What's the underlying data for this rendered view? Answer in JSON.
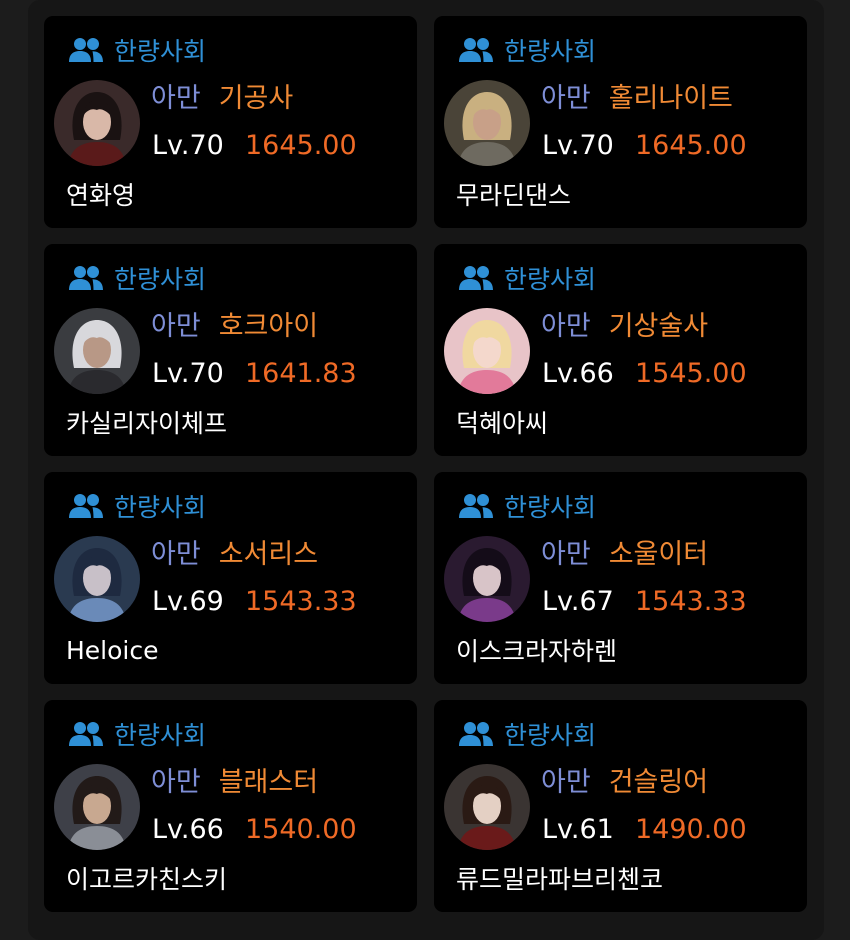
{
  "characters": [
    {
      "guild": "한량사회",
      "server": "아만",
      "class": "기공사",
      "level": "Lv.70",
      "item_level": "1645.00",
      "name": "연화영",
      "avatar": {
        "bg": "#3a2a2a",
        "hair": "#1a1212",
        "skin": "#d9b8a8",
        "accent": "#5a1a1a"
      }
    },
    {
      "guild": "한량사회",
      "server": "아만",
      "class": "홀리나이트",
      "level": "Lv.70",
      "item_level": "1645.00",
      "name": "무라딘댄스",
      "avatar": {
        "bg": "#4a4438",
        "hair": "#c9b080",
        "skin": "#c8a088",
        "accent": "#6e6a60"
      }
    },
    {
      "guild": "한량사회",
      "server": "아만",
      "class": "호크아이",
      "level": "Lv.70",
      "item_level": "1641.83",
      "name": "카실리자이체프",
      "avatar": {
        "bg": "#3a3c40",
        "hair": "#d8d8dc",
        "skin": "#b89886",
        "accent": "#2a2a2e"
      }
    },
    {
      "guild": "한량사회",
      "server": "아만",
      "class": "기상술사",
      "level": "Lv.66",
      "item_level": "1545.00",
      "name": "덕혜아씨",
      "avatar": {
        "bg": "#e8c4c8",
        "hair": "#f0d8a0",
        "skin": "#f4d8cc",
        "accent": "#e27a9a"
      }
    },
    {
      "guild": "한량사회",
      "server": "아만",
      "class": "소서리스",
      "level": "Lv.69",
      "item_level": "1543.33",
      "name": "Heloice",
      "avatar": {
        "bg": "#2a3a50",
        "hair": "#1e2a40",
        "skin": "#c8c0c8",
        "accent": "#6a8ab8"
      }
    },
    {
      "guild": "한량사회",
      "server": "아만",
      "class": "소울이터",
      "level": "Lv.67",
      "item_level": "1543.33",
      "name": "이스크라자하렌",
      "avatar": {
        "bg": "#2a1a30",
        "hair": "#140c18",
        "skin": "#d8c4c8",
        "accent": "#7a3a8a"
      }
    },
    {
      "guild": "한량사회",
      "server": "아만",
      "class": "블래스터",
      "level": "Lv.66",
      "item_level": "1540.00",
      "name": "이고르카친스키",
      "avatar": {
        "bg": "#3e4048",
        "hair": "#221a18",
        "skin": "#c8a890",
        "accent": "#8a8e96"
      }
    },
    {
      "guild": "한량사회",
      "server": "아만",
      "class": "건슬링어",
      "level": "Lv.61",
      "item_level": "1490.00",
      "name": "류드밀라파브리첸코",
      "avatar": {
        "bg": "#3a3432",
        "hair": "#2a1a14",
        "skin": "#e4d0c4",
        "accent": "#6a1a1a"
      }
    }
  ],
  "colors": {
    "guild_text": "#2f90d6",
    "server_text": "#7e8ed6",
    "class_text": "#f08a35",
    "item_level_text": "#ef6a26"
  },
  "icons": {
    "guild": "group-icon"
  }
}
